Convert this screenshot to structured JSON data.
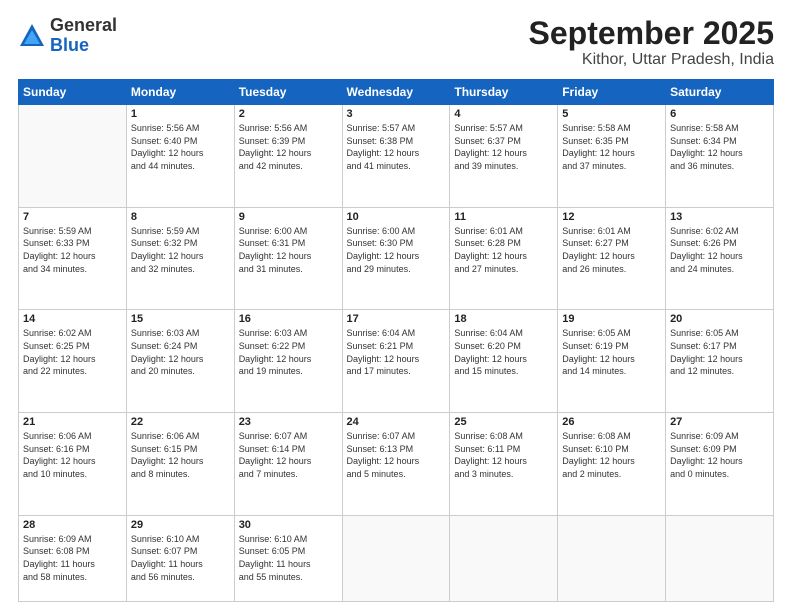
{
  "header": {
    "logo_general": "General",
    "logo_blue": "Blue",
    "month": "September 2025",
    "location": "Kithor, Uttar Pradesh, India"
  },
  "weekdays": [
    "Sunday",
    "Monday",
    "Tuesday",
    "Wednesday",
    "Thursday",
    "Friday",
    "Saturday"
  ],
  "weeks": [
    [
      {
        "day": "",
        "info": ""
      },
      {
        "day": "1",
        "info": "Sunrise: 5:56 AM\nSunset: 6:40 PM\nDaylight: 12 hours\nand 44 minutes."
      },
      {
        "day": "2",
        "info": "Sunrise: 5:56 AM\nSunset: 6:39 PM\nDaylight: 12 hours\nand 42 minutes."
      },
      {
        "day": "3",
        "info": "Sunrise: 5:57 AM\nSunset: 6:38 PM\nDaylight: 12 hours\nand 41 minutes."
      },
      {
        "day": "4",
        "info": "Sunrise: 5:57 AM\nSunset: 6:37 PM\nDaylight: 12 hours\nand 39 minutes."
      },
      {
        "day": "5",
        "info": "Sunrise: 5:58 AM\nSunset: 6:35 PM\nDaylight: 12 hours\nand 37 minutes."
      },
      {
        "day": "6",
        "info": "Sunrise: 5:58 AM\nSunset: 6:34 PM\nDaylight: 12 hours\nand 36 minutes."
      }
    ],
    [
      {
        "day": "7",
        "info": "Sunrise: 5:59 AM\nSunset: 6:33 PM\nDaylight: 12 hours\nand 34 minutes."
      },
      {
        "day": "8",
        "info": "Sunrise: 5:59 AM\nSunset: 6:32 PM\nDaylight: 12 hours\nand 32 minutes."
      },
      {
        "day": "9",
        "info": "Sunrise: 6:00 AM\nSunset: 6:31 PM\nDaylight: 12 hours\nand 31 minutes."
      },
      {
        "day": "10",
        "info": "Sunrise: 6:00 AM\nSunset: 6:30 PM\nDaylight: 12 hours\nand 29 minutes."
      },
      {
        "day": "11",
        "info": "Sunrise: 6:01 AM\nSunset: 6:28 PM\nDaylight: 12 hours\nand 27 minutes."
      },
      {
        "day": "12",
        "info": "Sunrise: 6:01 AM\nSunset: 6:27 PM\nDaylight: 12 hours\nand 26 minutes."
      },
      {
        "day": "13",
        "info": "Sunrise: 6:02 AM\nSunset: 6:26 PM\nDaylight: 12 hours\nand 24 minutes."
      }
    ],
    [
      {
        "day": "14",
        "info": "Sunrise: 6:02 AM\nSunset: 6:25 PM\nDaylight: 12 hours\nand 22 minutes."
      },
      {
        "day": "15",
        "info": "Sunrise: 6:03 AM\nSunset: 6:24 PM\nDaylight: 12 hours\nand 20 minutes."
      },
      {
        "day": "16",
        "info": "Sunrise: 6:03 AM\nSunset: 6:22 PM\nDaylight: 12 hours\nand 19 minutes."
      },
      {
        "day": "17",
        "info": "Sunrise: 6:04 AM\nSunset: 6:21 PM\nDaylight: 12 hours\nand 17 minutes."
      },
      {
        "day": "18",
        "info": "Sunrise: 6:04 AM\nSunset: 6:20 PM\nDaylight: 12 hours\nand 15 minutes."
      },
      {
        "day": "19",
        "info": "Sunrise: 6:05 AM\nSunset: 6:19 PM\nDaylight: 12 hours\nand 14 minutes."
      },
      {
        "day": "20",
        "info": "Sunrise: 6:05 AM\nSunset: 6:17 PM\nDaylight: 12 hours\nand 12 minutes."
      }
    ],
    [
      {
        "day": "21",
        "info": "Sunrise: 6:06 AM\nSunset: 6:16 PM\nDaylight: 12 hours\nand 10 minutes."
      },
      {
        "day": "22",
        "info": "Sunrise: 6:06 AM\nSunset: 6:15 PM\nDaylight: 12 hours\nand 8 minutes."
      },
      {
        "day": "23",
        "info": "Sunrise: 6:07 AM\nSunset: 6:14 PM\nDaylight: 12 hours\nand 7 minutes."
      },
      {
        "day": "24",
        "info": "Sunrise: 6:07 AM\nSunset: 6:13 PM\nDaylight: 12 hours\nand 5 minutes."
      },
      {
        "day": "25",
        "info": "Sunrise: 6:08 AM\nSunset: 6:11 PM\nDaylight: 12 hours\nand 3 minutes."
      },
      {
        "day": "26",
        "info": "Sunrise: 6:08 AM\nSunset: 6:10 PM\nDaylight: 12 hours\nand 2 minutes."
      },
      {
        "day": "27",
        "info": "Sunrise: 6:09 AM\nSunset: 6:09 PM\nDaylight: 12 hours\nand 0 minutes."
      }
    ],
    [
      {
        "day": "28",
        "info": "Sunrise: 6:09 AM\nSunset: 6:08 PM\nDaylight: 11 hours\nand 58 minutes."
      },
      {
        "day": "29",
        "info": "Sunrise: 6:10 AM\nSunset: 6:07 PM\nDaylight: 11 hours\nand 56 minutes."
      },
      {
        "day": "30",
        "info": "Sunrise: 6:10 AM\nSunset: 6:05 PM\nDaylight: 11 hours\nand 55 minutes."
      },
      {
        "day": "",
        "info": ""
      },
      {
        "day": "",
        "info": ""
      },
      {
        "day": "",
        "info": ""
      },
      {
        "day": "",
        "info": ""
      }
    ]
  ]
}
